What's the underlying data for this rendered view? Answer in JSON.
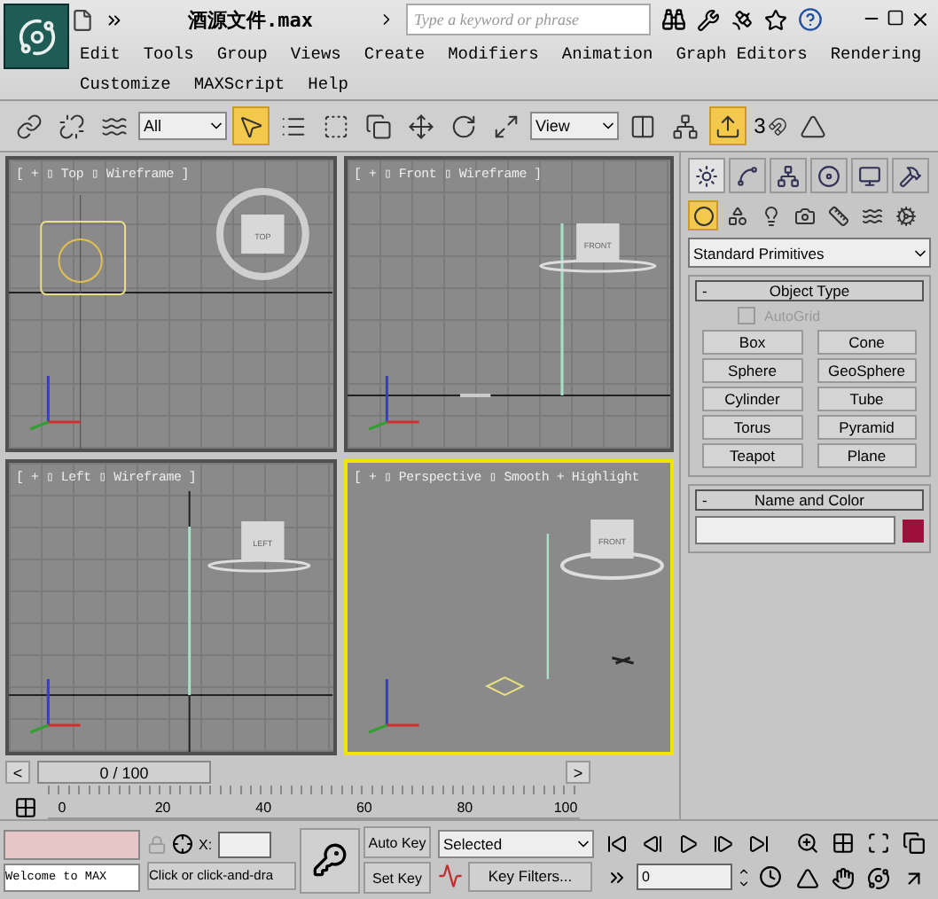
{
  "title_bar": {
    "file_name": "酒源文件.max",
    "search": {
      "placeholder": "Type a keyword or phrase"
    }
  },
  "menu_rows": [
    [
      "Edit",
      "Tools",
      "Group",
      "Views",
      "Create",
      "Modifiers",
      "Animation",
      "Graph Editors",
      "Rendering"
    ],
    [
      "Customize",
      "MAXScript",
      "Help"
    ]
  ],
  "toolbar": [
    {
      "kind": "link",
      "active": false
    },
    {
      "kind": "unlink",
      "active": false
    },
    {
      "kind": "bind",
      "active": false
    },
    {
      "kind": "dropdown",
      "value": "All"
    },
    {
      "kind": "select",
      "active": true
    },
    {
      "kind": "list",
      "active": false
    },
    {
      "kind": "region",
      "active": false
    },
    {
      "kind": "crossing",
      "active": false
    },
    {
      "kind": "move",
      "active": false
    },
    {
      "kind": "rotate",
      "active": false
    },
    {
      "kind": "scale",
      "active": false
    },
    {
      "kind": "dropdown",
      "value": "View"
    },
    {
      "kind": "pivot",
      "active": false
    },
    {
      "kind": "manipulate",
      "active": false
    },
    {
      "kind": "shortcut",
      "active": true
    },
    {
      "kind": "snap",
      "label": "3",
      "active": false
    },
    {
      "kind": "angle",
      "active": false
    }
  ],
  "viewports": [
    {
      "kind": "top",
      "label": "[ + ▯ Top ▯ Wireframe ]",
      "cube": "TOP",
      "selected": false
    },
    {
      "kind": "front",
      "label": "[ + ▯ Front ▯ Wireframe ]",
      "cube": "FRONT",
      "selected": false
    },
    {
      "kind": "left",
      "label": "[ + ▯ Left ▯ Wireframe ]",
      "cube": "LEFT",
      "selected": false
    },
    {
      "kind": "perspective",
      "label": "[ + ▯ Perspective ▯ Smooth + Highlight",
      "cube": "FRONT",
      "selected": true
    }
  ],
  "command_panel": {
    "tabs": [
      {
        "kind": "create",
        "selected": true
      },
      {
        "kind": "modify",
        "selected": false
      },
      {
        "kind": "hierarchy",
        "selected": false
      },
      {
        "kind": "motion",
        "selected": false
      },
      {
        "kind": "display",
        "selected": false
      },
      {
        "kind": "utilities",
        "selected": false
      }
    ],
    "categories": [
      {
        "kind": "geometry",
        "selected": true
      },
      {
        "kind": "shapes",
        "selected": false
      },
      {
        "kind": "lights",
        "selected": false
      },
      {
        "kind": "cameras",
        "selected": false
      },
      {
        "kind": "helpers",
        "selected": false
      },
      {
        "kind": "spacewarps",
        "selected": false
      },
      {
        "kind": "systems",
        "selected": false
      }
    ],
    "object_class": "Standard Primitives",
    "object_type": {
      "sign": "-",
      "title": "Object Type",
      "autogrid": {
        "label": "AutoGrid",
        "checked": false,
        "disabled": true
      },
      "buttons": [
        "Box",
        "Cone",
        "Sphere",
        "GeoSphere",
        "Cylinder",
        "Tube",
        "Torus",
        "Pyramid",
        "Teapot",
        "Plane"
      ]
    },
    "name_and_color": {
      "sign": "-",
      "title": "Name and Color",
      "color": "#9e0f3c"
    }
  },
  "time_slider": {
    "prev": "<",
    "position": "0 / 100",
    "level": 0,
    "next": ">"
  },
  "track_bar": {
    "ticks": [
      "0",
      "20",
      "40",
      "60",
      "80",
      "100"
    ]
  },
  "status": {
    "listener_output": "Welcome to MAX",
    "x_label": "X:",
    "prompt": "Click or click-and-dra",
    "auto_key": "Auto Key",
    "set_key": "Set Key",
    "key_mode": "Selected",
    "key_filters": "Key Filters...",
    "frame": "0"
  }
}
